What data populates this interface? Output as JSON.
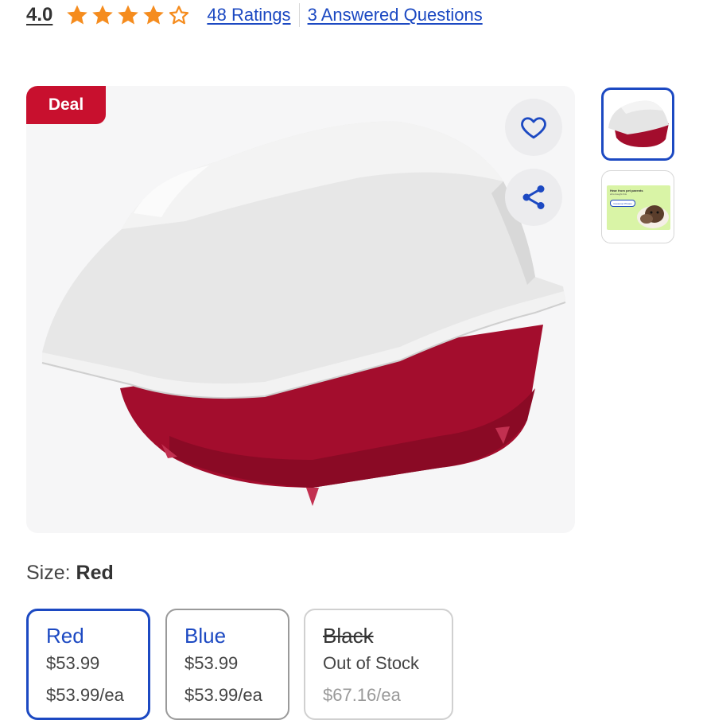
{
  "rating": {
    "value": "4.0",
    "stars": 4,
    "max_stars": 5,
    "ratings_link": "48 Ratings",
    "questions_link": "3 Answered Questions"
  },
  "gallery": {
    "deal_badge": "Deal",
    "favorite_icon": "heart-outline-icon",
    "share_icon": "share-icon",
    "thumbnail_2": {
      "title": "Hear from pet parents",
      "subtitle": "who bought this",
      "button": "Customer Photos"
    }
  },
  "size": {
    "label": "Size:",
    "selected": "Red",
    "options": [
      {
        "name": "Red",
        "price": "$53.99",
        "unit_price": "$53.99/ea"
      },
      {
        "name": "Blue",
        "price": "$53.99",
        "unit_price": "$53.99/ea"
      },
      {
        "name": "Black",
        "price": "Out of Stock",
        "unit_price": "$67.16/ea"
      }
    ]
  },
  "colors": {
    "accent_blue": "#1c49c2",
    "deal_red": "#c8102e",
    "star_orange": "#f58c1e",
    "product_red": "#a30d2d"
  }
}
